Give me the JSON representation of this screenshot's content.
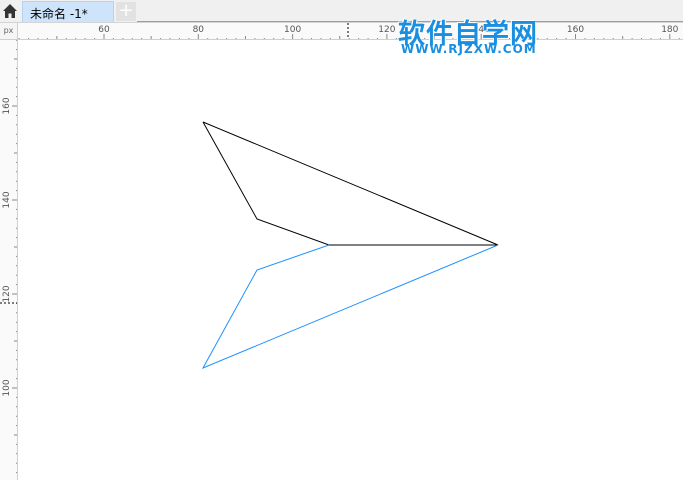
{
  "tabs": {
    "home_icon": "home-icon",
    "document_title": "未命名 -1*",
    "new_tab_icon": "plus-icon"
  },
  "ruler": {
    "corner_label": "px",
    "horizontal_ticks": [
      "60",
      "80",
      "100",
      "120",
      "140",
      "160",
      "180"
    ],
    "vertical_ticks": [
      "160",
      "140",
      "120",
      "100"
    ]
  },
  "shape": {
    "upper_stroke_color": "#000000",
    "lower_stroke_color": "#1e90ff"
  },
  "watermark": {
    "title": "软件自学网",
    "url": "WWW.RJZXW.COM",
    "color": "#1a8fe0"
  }
}
